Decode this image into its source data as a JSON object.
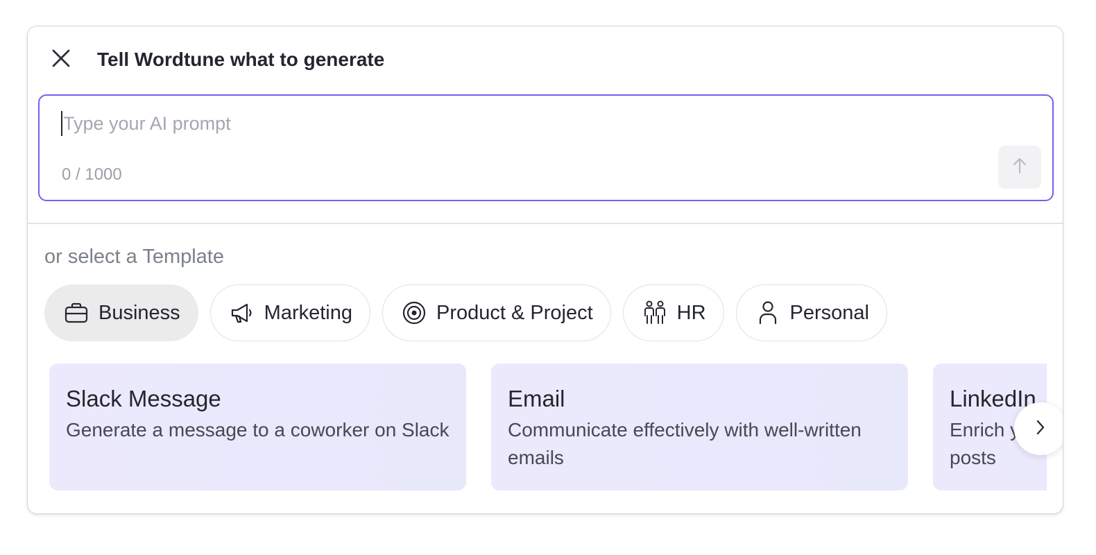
{
  "header": {
    "title": "Tell Wordtune what to generate",
    "close_icon": "close-icon"
  },
  "prompt": {
    "placeholder": "Type your AI prompt",
    "value": "",
    "counter": "0 / 1000",
    "send_icon": "arrow-up-icon"
  },
  "templates": {
    "label": "or select a Template",
    "categories": [
      {
        "label": "Business",
        "icon": "briefcase-icon",
        "active": true
      },
      {
        "label": "Marketing",
        "icon": "megaphone-icon",
        "active": false
      },
      {
        "label": "Product & Project",
        "icon": "target-icon",
        "active": false
      },
      {
        "label": "HR",
        "icon": "people-icon",
        "active": false
      },
      {
        "label": "Personal",
        "icon": "person-icon",
        "active": false
      }
    ],
    "cards": [
      {
        "title": "Slack Message",
        "description": "Generate a message to a coworker on Slack"
      },
      {
        "title": "Email",
        "description": "Communicate effectively with well-written emails"
      },
      {
        "title": "LinkedIn",
        "description": "Enrich your profile by sharing engaging posts"
      }
    ],
    "next_icon": "chevron-right-icon"
  },
  "colors": {
    "accent": "#7a5cf0",
    "card_bg": "#ece9fd",
    "chip_active_bg": "#ebebec"
  }
}
